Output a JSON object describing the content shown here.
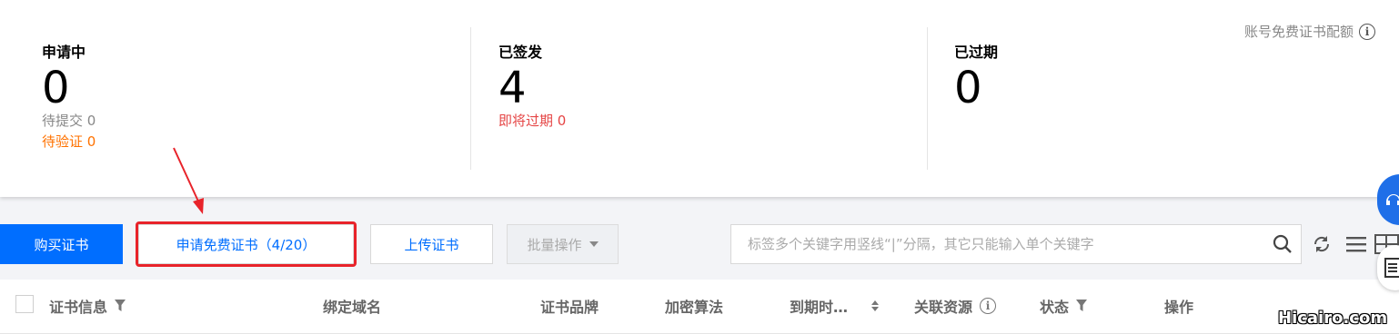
{
  "stats": {
    "pending": {
      "title": "申请中",
      "count": "0",
      "submit_label": "待提交 0",
      "verify_label": "待验证 0"
    },
    "issued": {
      "title": "已签发",
      "count": "4",
      "expiring_label": "即将过期 0"
    },
    "expired": {
      "title": "已过期",
      "count": "0"
    },
    "quota_label": "账号免费证书配额"
  },
  "toolbar": {
    "buy_label": "购买证书",
    "apply_free_label": "申请免费证书（4/20）",
    "upload_label": "上传证书",
    "batch_label": "批量操作",
    "search_placeholder": "标签多个关键字用竖线“|”分隔，其它只能输入单个关键字"
  },
  "table": {
    "columns": {
      "cert_info": "证书信息",
      "domain": "绑定域名",
      "brand": "证书品牌",
      "algorithm": "加密算法",
      "expiry": "到期时…",
      "resources": "关联资源",
      "status": "状态",
      "actions": "操作"
    }
  },
  "watermark": "Hicairo.com",
  "colors": {
    "primary": "#006eff",
    "warning": "#ff7200",
    "danger": "#e54545",
    "highlight": "#e8232a"
  }
}
